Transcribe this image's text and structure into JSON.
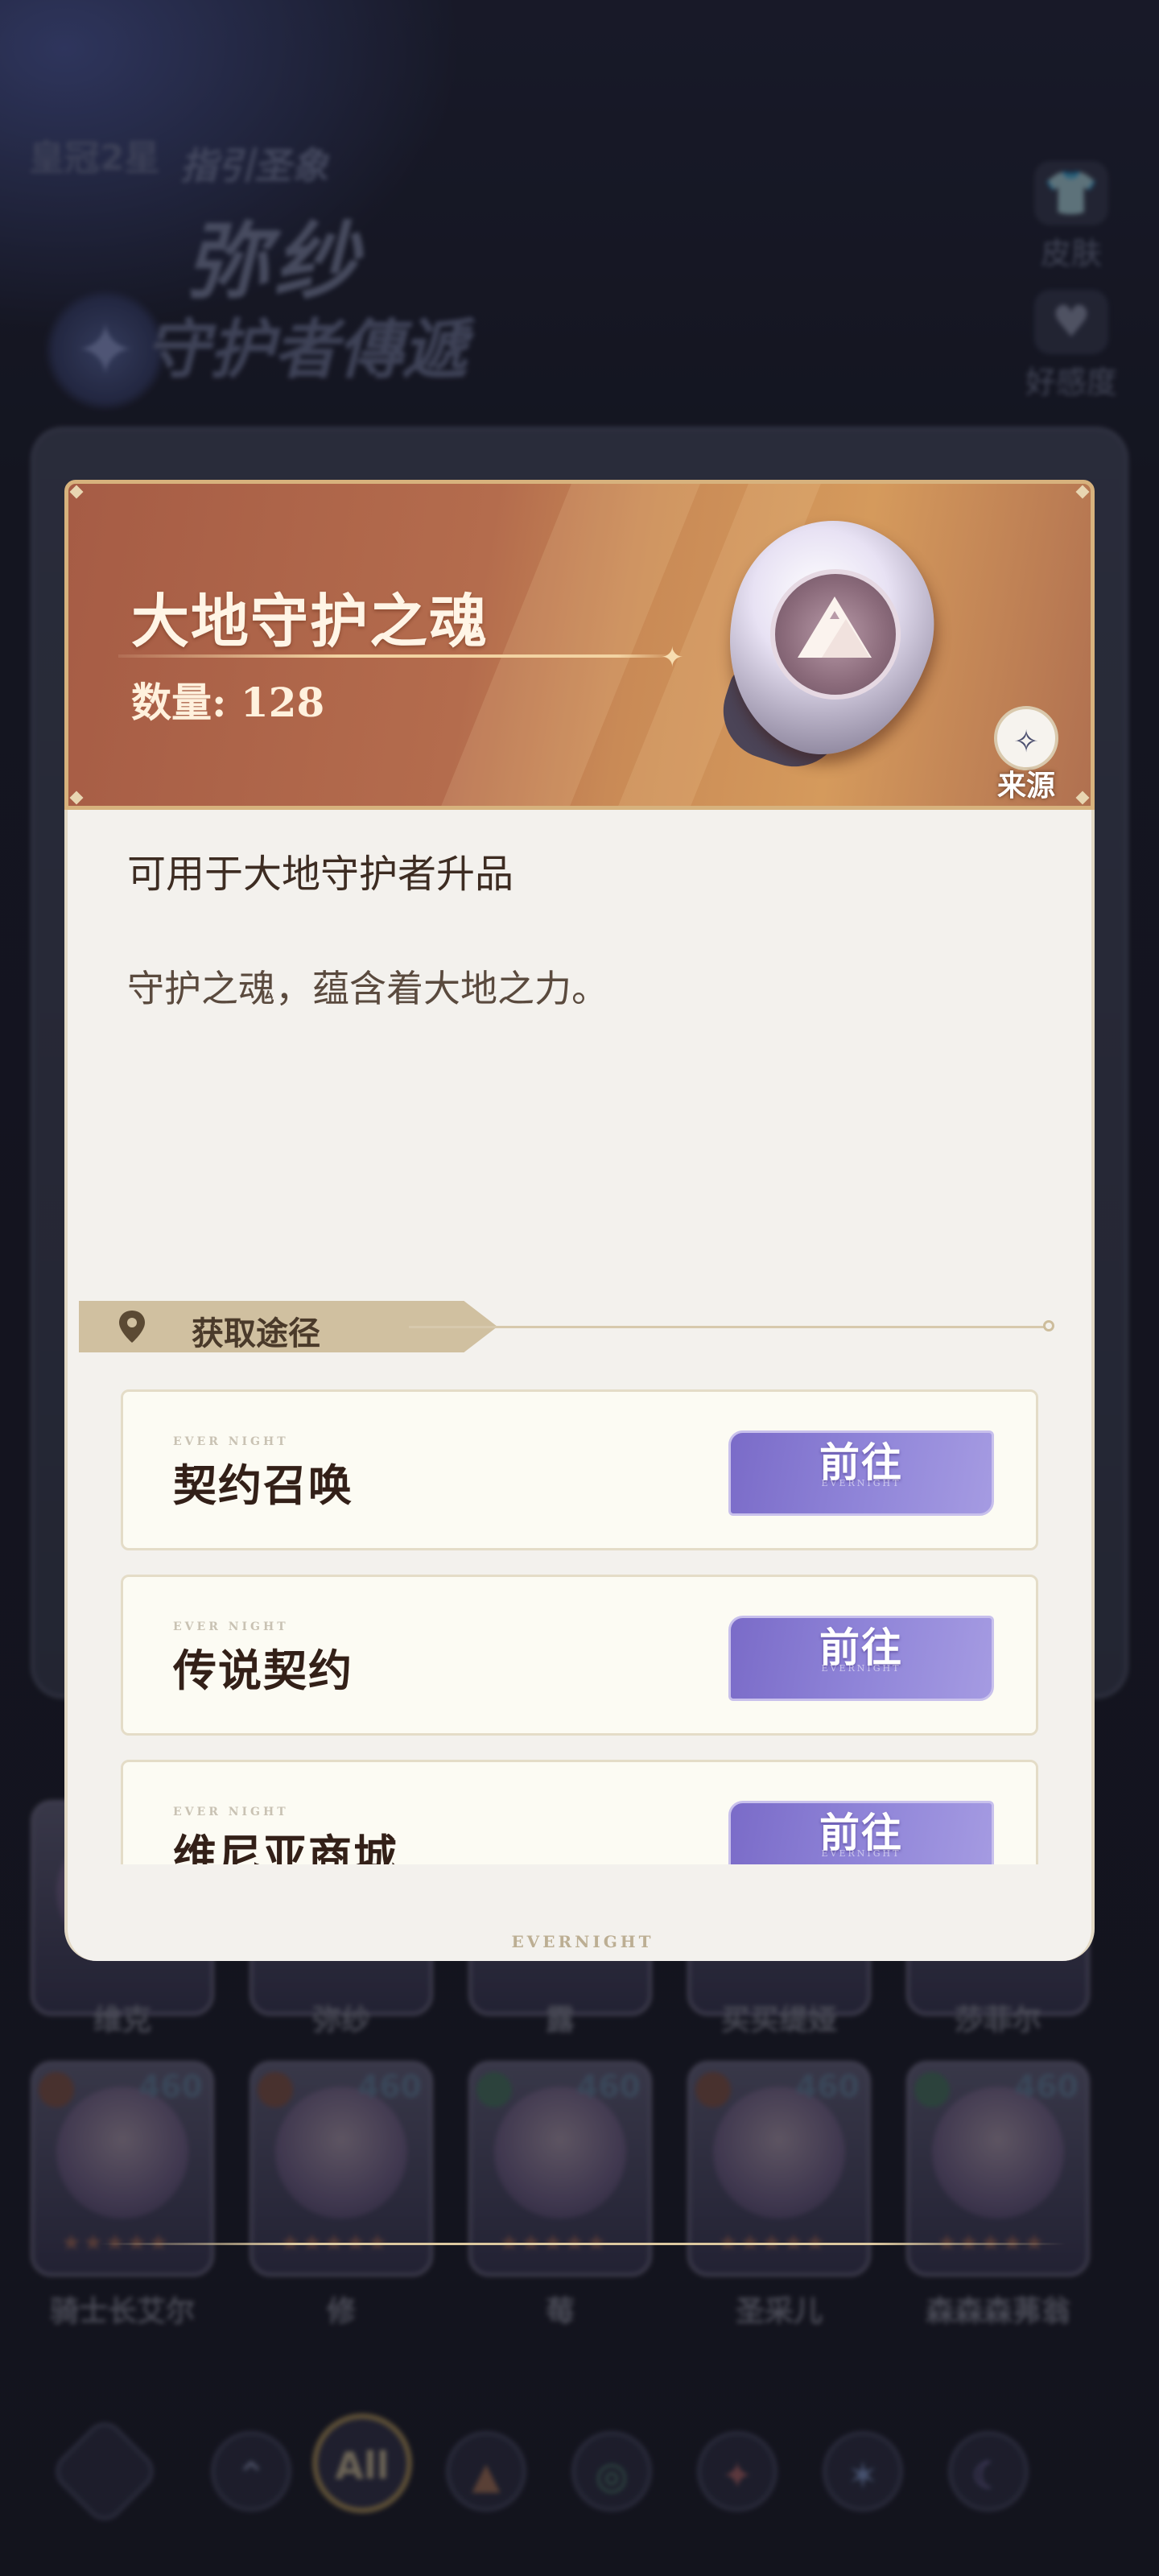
{
  "background": {
    "rank_label": "皇冠2星",
    "subtitle": "指引圣象",
    "hero_name": "弥纱",
    "hero_title": "守护者傳遞",
    "side_buttons": [
      {
        "label": "皮肤",
        "icon": "shirt-icon"
      },
      {
        "label": "好感度",
        "icon": "heart-icon"
      }
    ],
    "roster_row1_names": [
      "维克",
      "弥纱",
      "露",
      "买买缇娅",
      "莎菲尔"
    ],
    "roster_row2": [
      {
        "name": "骑士长艾尔",
        "level": "460"
      },
      {
        "name": "修",
        "level": "460"
      },
      {
        "name": "莓",
        "level": "460"
      },
      {
        "name": "圣采儿",
        "level": "460"
      },
      {
        "name": "森森森茀翁",
        "level": "460"
      }
    ],
    "bottom_nav": [
      {
        "icon": "logo-icon",
        "label": ""
      },
      {
        "icon": "chevrons-up-icon",
        "label": "⌃"
      },
      {
        "icon": "all-filter-icon",
        "label": "All"
      },
      {
        "icon": "mountain-icon",
        "label": "▲"
      },
      {
        "icon": "wind-icon",
        "label": "◎"
      },
      {
        "icon": "fire-icon",
        "label": "✦"
      },
      {
        "icon": "star-icon",
        "label": "✶"
      },
      {
        "icon": "moon-icon",
        "label": "☾"
      }
    ]
  },
  "modal": {
    "item_name": "大地守护之魂",
    "quantity_label": "数量: 128",
    "source_label": "来源",
    "usage_text": "可用于大地守护者升品",
    "flavor_text": "守护之魂，蕴含着大地之力。",
    "acquire_title": "获取途径",
    "routes": [
      {
        "tag": "EVER NIGHT",
        "name": "契约召唤",
        "button": "前往",
        "button_sub": "EVERNIGHT"
      },
      {
        "tag": "EVER NIGHT",
        "name": "传说契约",
        "button": "前往",
        "button_sub": "EVERNIGHT"
      },
      {
        "tag": "EVER NIGHT",
        "name": "维尼亚商城",
        "button": "前往",
        "button_sub": "EVERNIGHT"
      }
    ],
    "footer_logo": "EVERNIGHT"
  },
  "colors": {
    "header_start": "#a65c45",
    "header_end": "#d59a5c",
    "button_purple": "#8f84d8",
    "body_bg": "#f3f1ed"
  }
}
